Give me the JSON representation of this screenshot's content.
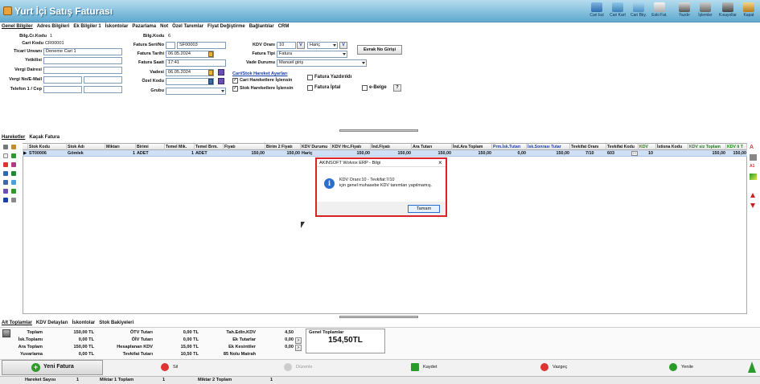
{
  "window": {
    "title": "Yurt İçi Satış Faturası"
  },
  "toolbar": [
    {
      "label": "Cari bul",
      "icon": "search-customer-icon"
    },
    {
      "label": "Cari Kart",
      "icon": "customer-card-icon"
    },
    {
      "label": "Cari Bky.",
      "icon": "customer-balance-icon"
    },
    {
      "label": "Eski Fat.",
      "icon": "old-invoice-icon"
    },
    {
      "label": "Yazdır",
      "icon": "printer-icon"
    },
    {
      "label": "İşlemler",
      "icon": "operations-icon"
    },
    {
      "label": "Kısayollar",
      "icon": "shortcuts-icon"
    },
    {
      "label": "Kapat",
      "icon": "close-door-icon"
    }
  ],
  "top_tabs": [
    "Genel Bilgiler",
    "Adres Bilgileri",
    "Ek Bilgiler 1",
    "İskontolar",
    "Pazarlama",
    "Not",
    "Özel Tanımlar",
    "Fiyat Değiştirme",
    "Bağlantılar",
    "CRM"
  ],
  "left": {
    "bilg_cr_kodu_label": "Bilg.Cr.Kodu",
    "bilg_cr_kodu_value": "1",
    "cari_kodu_label": "Cari Kodu",
    "cari_kodu_value": "CR00001",
    "ticari_unvan_label": "Ticari Unvanı",
    "ticari_unvan_value": "Deneme Cari 1",
    "yetkilisi_label": "Yetkilisi",
    "vergi_dairesi_label": "Vergi Dairesi",
    "vergi_no_label": "Vergi No/E-Mail",
    "telefon_label": "Telefon 1 / Cep"
  },
  "middle": {
    "bilg_kodu_label": "Bilg.Kodu",
    "bilg_kodu_value": "6",
    "seri_no_label": "Fatura Seri/No",
    "seri_no_value": "SF00003",
    "fatura_tarihi_label": "Fatura Tarihi",
    "fatura_tarihi_value": "06.05.2024",
    "fatura_saati_label": "Fatura Saati",
    "fatura_saati_value": "17:41",
    "vadesi_label": "Vadesi",
    "vadesi_value": "06.05.2024",
    "ozel_kodu_label": "Özel Kodu",
    "grubu_label": "Grubu"
  },
  "right": {
    "kdv_orani_label": "KDV Oranı",
    "kdv_orani_value": "10",
    "kdv_v_button": "V",
    "kdv_haric_value": "Hariç",
    "kdv_v2_button": "V",
    "fatura_tipi_label": "Fatura Tipi",
    "fatura_tipi_value": "Fatura",
    "vade_durumu_label": "Vade Durumu",
    "vade_durumu_value": "Manuel giriş",
    "evrak_no_button": "Evrak No Girişi",
    "cari_stok_title": "Cari/Stok Hareket Ayarları",
    "cari_hareket_label": "Cari Hareketlere İşlensin",
    "stok_hareket_label": "Stok Hareketlere İşlensin",
    "fatura_yazdirildi_label": "Fatura Yazdırıldı",
    "fatura_iptal_label": "Fatura İptal",
    "e_belge_label": "e-Belge",
    "help_button": "?"
  },
  "mid_tabs": [
    "Hareketler",
    "Kaçak Fatura"
  ],
  "grid": {
    "columns": [
      "Stok Kodu",
      "Stok Adı",
      "Miktarı",
      "Birimi",
      "Temel Mik.",
      "Temel Brm.",
      "Fiyatı",
      "Birim 2 Fiyatı",
      "KDV Durumu",
      "KDV Hrc.Fiyatı",
      "İnd.Fiyatı",
      "Ara Tutarı",
      "İnd.Ara Toplam",
      "Prm.İsk.Tutarı",
      "İsk.Sonrası Tutar",
      "Tevkifat Oranı",
      "Tevkifat Kodu",
      "KDV",
      "İstisna Kodu",
      "KDV siz Toplam",
      "KDV li T"
    ],
    "row": [
      "ST00006",
      "Gömlek",
      "1",
      "ADET",
      "1",
      "ADET",
      "150,00",
      "150,00",
      "Hariç",
      "150,00",
      "150,00",
      "150,00",
      "150,00",
      "0,00",
      "150,00",
      "7/10",
      "603",
      "10",
      "",
      "150,00",
      "150,00"
    ]
  },
  "dialog": {
    "title": "AKINSOFT Wolvox ERP - Bilgi",
    "line1": "KDV Oranı:10 - Tevkifat:7/10",
    "line2": "için genel muhasebe KDV tanımları yapılmamış.",
    "ok_button": "Tamam",
    "close_glyph": "×"
  },
  "bottom_tabs": [
    "Alt Toplamlar",
    "KDV Detayları",
    "İskontolar",
    "Stok Bakiyeleri"
  ],
  "totals": {
    "toplam_label": "Toplam",
    "toplam_value": "150,00 TL",
    "isk_toplami_label": "İsk.Toplamı",
    "isk_toplami_value": "0,00 TL",
    "ara_toplam_label": "Ara Toplam",
    "ara_toplam_value": "150,00 TL",
    "yuvarlama_label": "Yuvarlama",
    "yuvarlama_value": "0,00 TL",
    "otv_label": "ÖTV Tutarı",
    "otv_value": "0,00 TL",
    "oiv_label": "ÖİV Tutarı",
    "oiv_value": "0,00 TL",
    "hesaplanan_kdv_label": "Hesaplanan KDV",
    "hesaplanan_kdv_value": "15,00 TL",
    "tevkifat_label": "Tevkifat Tutarı",
    "tevkifat_value": "10,50 TL",
    "tah_edln_kdv_label": "Tah.Edln.KDV",
    "tah_edln_kdv_value": "4,50",
    "ek_tutarlar_label": "Ek Tutarlar",
    "ek_tutarlar_value": "0,00",
    "ek_kesintiler_label": "Ek Kesintiler",
    "ek_kesintiler_value": "0,00",
    "matrah_label": "85 Nolu Matrah",
    "genel_toplam_label": "Genel Toplamlar",
    "genel_toplam_value": "154,50TL"
  },
  "actions": {
    "yeni_fatura": "Yeni Fatura",
    "sil": "Sil",
    "duzenle": "Düzenle",
    "kaydet": "Kaydet",
    "vazgec": "Vazgeç",
    "yenile": "Yenile"
  },
  "status": {
    "hareket_sayisi_label": "Hareket Sayısı",
    "hareket_sayisi_value": "1",
    "miktar1_label": "Miktar 1 Toplam",
    "miktar1_value": "1",
    "miktar2_label": "Miktar 2 Toplam",
    "miktar2_value": "1"
  },
  "colors": {
    "title_bar": "#5fa9cf",
    "dialog_border": "#d9222a",
    "row_highlight": "#cfe0f6",
    "link_blue": "#1a3fa8",
    "green_header": "#1b7d1b"
  }
}
